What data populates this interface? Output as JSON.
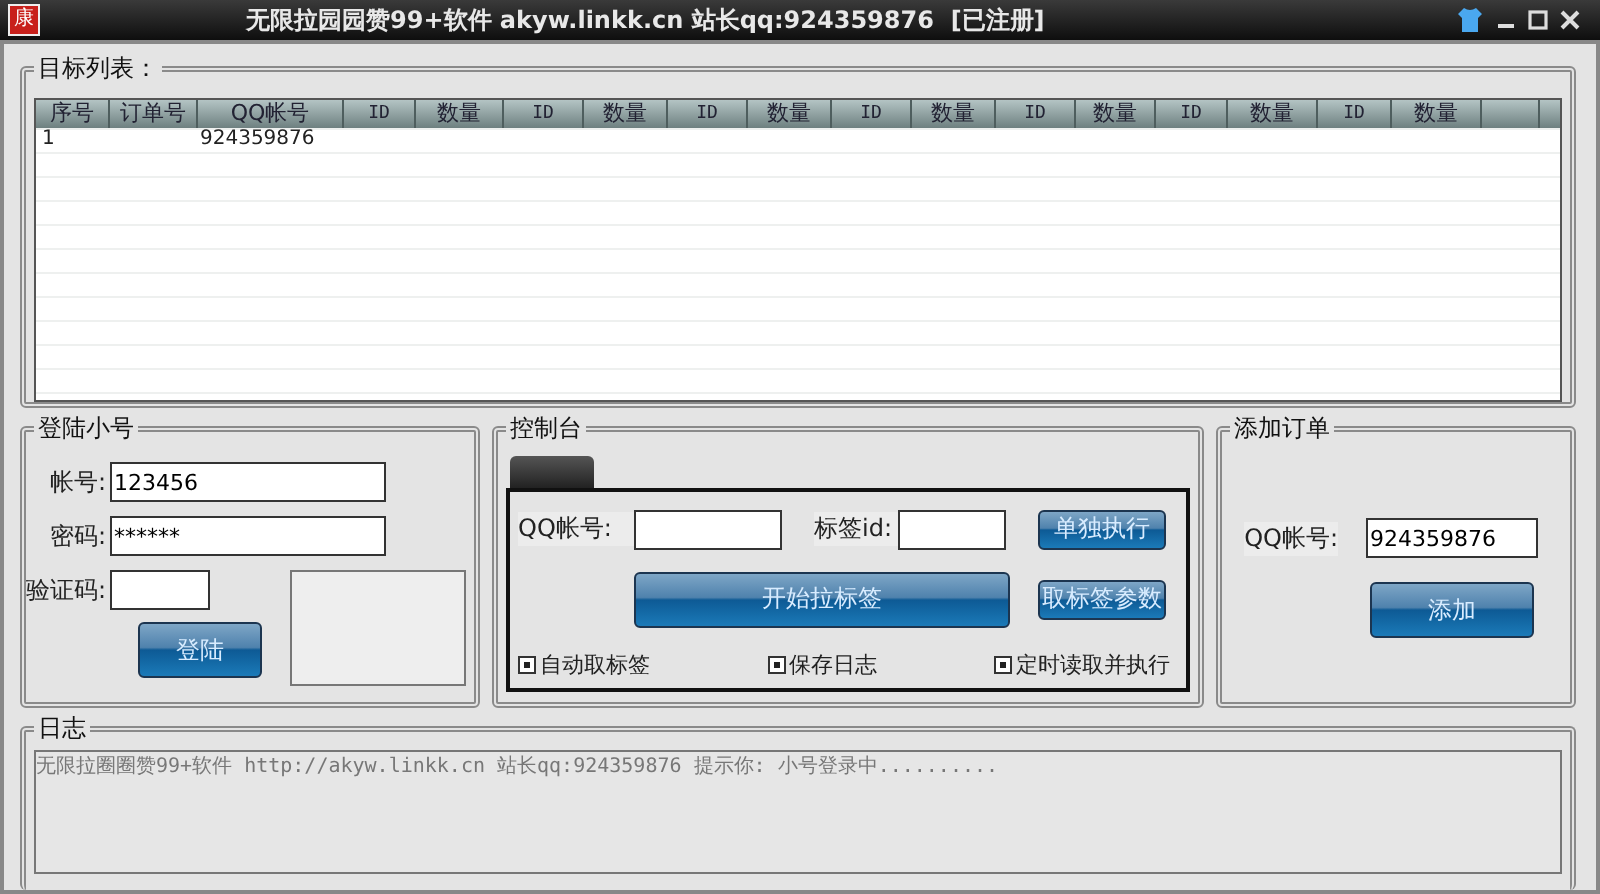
{
  "window": {
    "app_icon": "康",
    "title": "无限拉园园赞99+软件 akyw.linkk.cn 站长qq:924359876  [已注册]"
  },
  "target_list": {
    "title": "目标列表：",
    "columns": [
      "序号",
      "订单号",
      "QQ帐号",
      "ID",
      "数量",
      "ID",
      "数量",
      "ID",
      "数量",
      "ID",
      "数量",
      "ID",
      "数量",
      "ID",
      "数量",
      "ID",
      "数量"
    ],
    "rows": [
      {
        "index": "1",
        "qq": "924359876"
      }
    ]
  },
  "login": {
    "title": "登陆小号",
    "account_label": "帐号:",
    "account_value": "123456",
    "password_label": "密码:",
    "password_value": "******",
    "captcha_label": "验证码:",
    "button": "登陆"
  },
  "console": {
    "title": "控制台",
    "qq_label": "QQ帐号:",
    "tag_label": "标签id:",
    "run_single": "单独执行",
    "start": "开始拉标签",
    "fetch_params": "取标签参数",
    "checkboxes": [
      {
        "label": "自动取标签",
        "checked": true
      },
      {
        "label": "保存日志",
        "checked": true
      },
      {
        "label": "定时读取并执行",
        "checked": true
      }
    ]
  },
  "add_order": {
    "title": "添加订单",
    "qq_label": "QQ帐号:",
    "qq_value": "924359876",
    "button": "添加"
  },
  "log": {
    "title": "日志",
    "lines": [
      "无限拉圈圈赞99+软件 http://akyw.linkk.cn 站长qq:924359876 提示你: 小号登录中.........."
    ]
  }
}
